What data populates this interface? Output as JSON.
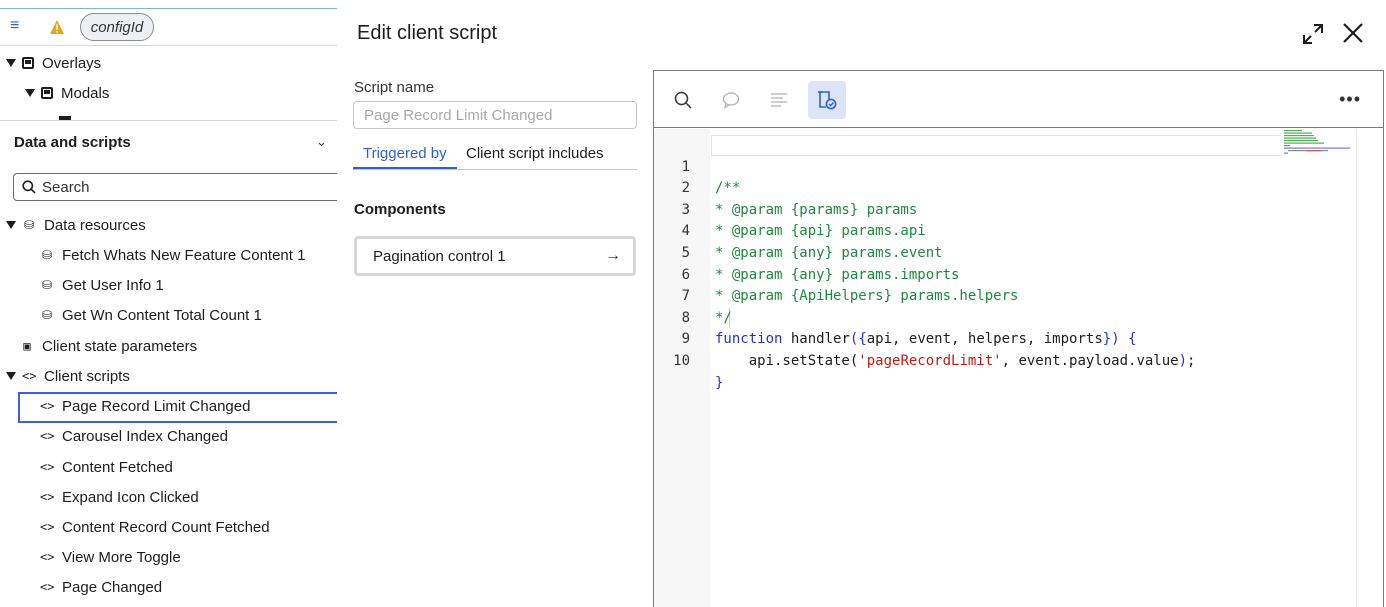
{
  "topbar": {
    "config_pill": "configId"
  },
  "tree": {
    "overlays": "Overlays",
    "modals": "Modals"
  },
  "data_scripts": {
    "title": "Data and scripts",
    "search_placeholder": "Search",
    "data_resources": "Data resources",
    "resources": [
      "Fetch Whats New Feature Content 1",
      "Get User Info 1",
      "Get Wn Content Total Count 1"
    ],
    "client_state": "Client state parameters",
    "client_scripts": "Client scripts",
    "scripts": [
      "Page Record Limit Changed",
      "Carousel Index Changed",
      "Content Fetched",
      "Expand Icon Clicked",
      "Content Record Count Fetched",
      "View More Toggle",
      "Page Changed"
    ]
  },
  "modal": {
    "title": "Edit client script",
    "script_name_label": "Script name",
    "script_name_placeholder": "Page Record Limit Changed",
    "tabs": [
      "Triggered by",
      "Client script includes"
    ],
    "components_title": "Components",
    "component": "Pagination control 1"
  },
  "editor": {
    "more": "•••",
    "lines": [
      {
        "n": "1",
        "t": "/**"
      },
      {
        "n": "2",
        "t": "* @param {params} params"
      },
      {
        "n": "3",
        "t": "* @param {api} params.api"
      },
      {
        "n": "4",
        "t": "* @param {any} params.event"
      },
      {
        "n": "5",
        "t": "* @param {any} params.imports"
      },
      {
        "n": "6",
        "t": "* @param {ApiHelpers} params.helpers"
      },
      {
        "n": "7",
        "t": "*/"
      },
      {
        "n": "8",
        "kw": "function",
        "mid": " handler",
        "p1": "(",
        "b1": "{",
        "args": "api, event, helpers, imports",
        "b2": "}",
        "p2": ")",
        "end": " {"
      },
      {
        "n": "9",
        "pre": "    api.setState(",
        "str": "'pageRecordLimit'",
        "post": ", event.payload.value",
        "close": ")",
        "semi": ";"
      },
      {
        "n": "10",
        "t": "}"
      }
    ]
  },
  "colors": {
    "accent": "#2f63c8",
    "comment": "#1b8a3c",
    "keyword": "#2533c7",
    "string": "#c41a16"
  }
}
